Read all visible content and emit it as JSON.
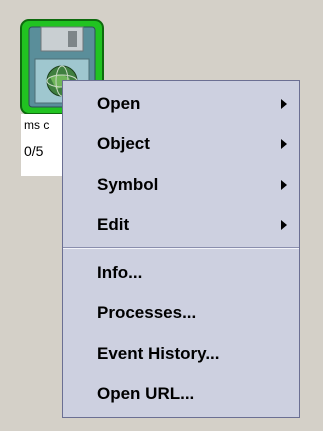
{
  "node": {
    "icon": "floppy-disk-globe-icon",
    "name_label": "ms c",
    "count_label": "0/5",
    "status_color": "#21c321"
  },
  "context_menu": {
    "items": [
      {
        "label": "Open",
        "has_submenu": true
      },
      {
        "label": "Object",
        "has_submenu": true
      },
      {
        "label": "Symbol",
        "has_submenu": true
      },
      {
        "label": "Edit",
        "has_submenu": true
      },
      {
        "label": "Info...",
        "has_submenu": false
      },
      {
        "label": "Processes...",
        "has_submenu": false
      },
      {
        "label": "Event History...",
        "has_submenu": false
      },
      {
        "label": "Open URL...",
        "has_submenu": false
      }
    ],
    "arrow_icon": "chevron-right-icon"
  },
  "colors": {
    "desktop_background": "#d4d0c8",
    "menu_background": "#cdd0e0",
    "menu_border": "#6b6f93"
  }
}
